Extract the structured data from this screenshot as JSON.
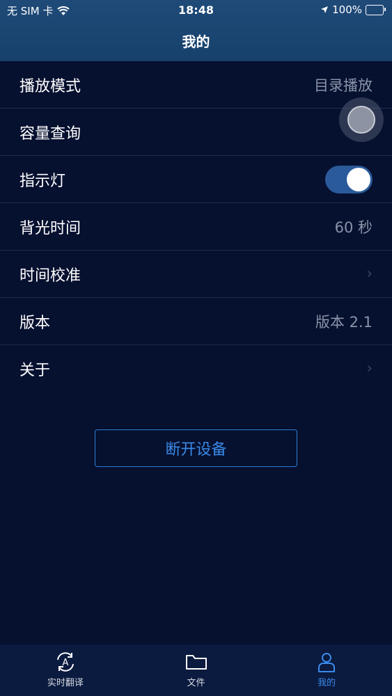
{
  "status_bar": {
    "carrier": "无 SIM 卡",
    "time": "18:48",
    "battery": "100%"
  },
  "header": {
    "title": "我的"
  },
  "settings": [
    {
      "label": "播放模式",
      "value": "目录播放"
    },
    {
      "label": "容量查询",
      "value": ""
    },
    {
      "label": "指示灯",
      "value": "",
      "toggle_on": true
    },
    {
      "label": "背光时间",
      "value": "60 秒"
    },
    {
      "label": "时间校准",
      "value": ""
    },
    {
      "label": "版本",
      "value": "版本 2.1"
    },
    {
      "label": "关于",
      "value": ""
    }
  ],
  "disconnect_button": {
    "label": "断开设备"
  },
  "tabs": [
    {
      "label": "实时翻译",
      "icon": "translate-icon",
      "active": false
    },
    {
      "label": "文件",
      "icon": "folder-icon",
      "active": false
    },
    {
      "label": "我的",
      "icon": "person-icon",
      "active": true
    }
  ],
  "colors": {
    "background": "#06102f",
    "header": "#1f4a78",
    "accent": "#3a8ae8",
    "toggle_on": "#2a5a9a"
  }
}
